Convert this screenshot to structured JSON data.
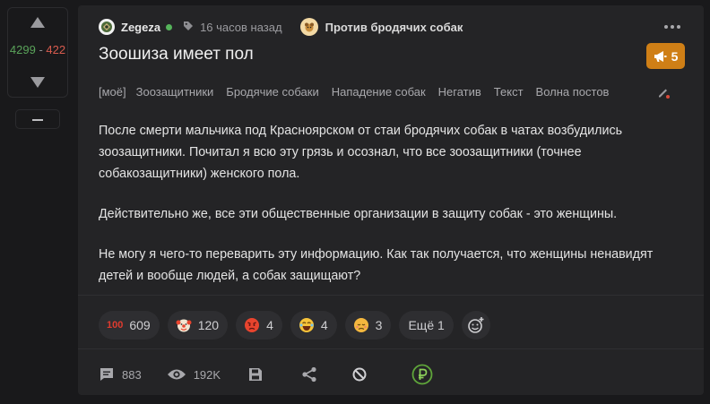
{
  "vote": {
    "plus": "4299",
    "separator": "-",
    "minus": "422"
  },
  "post": {
    "author": "Zegeza",
    "time": "16 часов назад",
    "community": "Против бродячих собак",
    "title": "Зоошиза имеет пол",
    "badge_count": "5",
    "tags": [
      "[моё]",
      "Зоозащитники",
      "Бродячие собаки",
      "Нападение собак",
      "Негатив",
      "Текст",
      "Волна постов"
    ],
    "body": [
      "После смерти мальчика под Красноярском от стаи бродячих собак в чатах возбудились зоозащитники. Почитал я всю эту грязь и осознал, что все зоозащитники (точнее собакозащитники) женского пола.",
      "Действительно же, все эти общественные организации в защиту собак - это женщины.",
      "Не могу я чего-то переварить эту информацию. Как так получается, что женщины ненавидят детей и вообще людей, а собак защищают?"
    ]
  },
  "reactions": [
    {
      "icon": "hundred-points-icon",
      "count": "609",
      "color": "#e03b2f",
      "glyph": "100"
    },
    {
      "icon": "clown-face-icon",
      "count": "120",
      "color": "#f2e4d0",
      "glyph": ""
    },
    {
      "icon": "angry-face-icon",
      "count": "4",
      "color": "#e8442e",
      "glyph": ""
    },
    {
      "icon": "laughing-face-icon",
      "count": "4",
      "color": "#f6c33a",
      "glyph": ""
    },
    {
      "icon": "sad-face-icon",
      "count": "3",
      "color": "#f4b73e",
      "glyph": ""
    }
  ],
  "reactions_more": "Ещё 1",
  "footer": {
    "comments": "883",
    "views": "192K"
  }
}
